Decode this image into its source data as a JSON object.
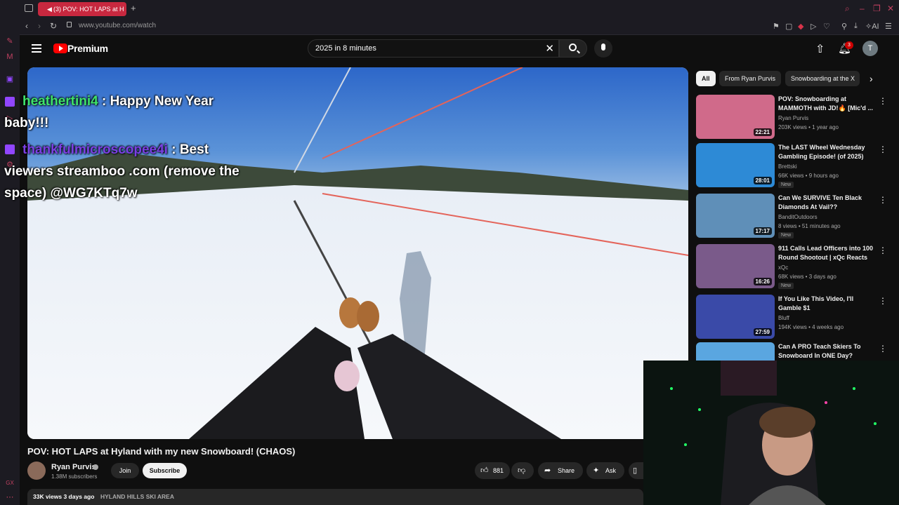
{
  "browser": {
    "tab_title": "(3) POV: HOT LAPS at H",
    "url": "www.youtube.com/watch",
    "new_tab": "+",
    "ai_label": "AI"
  },
  "youtube": {
    "brand": "Premium",
    "search_value": "2025 in 8 minutes",
    "notification_count": "3",
    "user_initial": "T"
  },
  "chat_overlay": [
    {
      "user": "heathertini4",
      "user_color": "#3fe36a",
      "text": " : Happy New Year",
      "text2": "baby!!!"
    },
    {
      "user": "thankfulmicroscopee4i",
      "user_color": "#7b3fe3",
      "text": " : Best",
      "text2": "viewers streamboo .com (remove the",
      "text3": "space) @WG7KTq7w"
    }
  ],
  "video": {
    "title": "POV: HOT LAPS at Hyland with my new Snowboard! (CHAOS)",
    "channel": "Ryan Purvis",
    "subscribers": "1.38M subscribers",
    "join_label": "Join",
    "subscribe_label": "Subscribe",
    "likes": "881",
    "share_label": "Share",
    "ask_label": "Ask",
    "views_date": "33K views  3 days ago",
    "tag": "HYLAND HILLS SKI AREA"
  },
  "chips": [
    "All",
    "From Ryan Purvis",
    "Snowboarding at the X"
  ],
  "recommendations": [
    {
      "title": "POV: Snowboarding at MAMMOTH with JD!🔥 [Mic'd ...",
      "channel": "Ryan Purvis",
      "meta": "203K views • 1 year ago",
      "duration": "22:21",
      "new": "",
      "thumb_color": "#d06a8a"
    },
    {
      "title": "The LAST Wheel Wednesday Gambling Episode! (of 2025)",
      "channel": "Brettski",
      "meta": "66K views • 9 hours ago",
      "duration": "28:01",
      "new": "New",
      "thumb_color": "#2d8ad6"
    },
    {
      "title": "Can We SURVIVE Ten Black Diamonds At Vail??",
      "channel": "BanditOutdoors",
      "meta": "8 views • 51 minutes ago",
      "duration": "17:17",
      "new": "New",
      "thumb_color": "#5f8fb8"
    },
    {
      "title": "911 Calls Lead Officers into 100 Round Shootout | xQc Reacts",
      "channel": "xQc",
      "meta": "68K views • 3 days ago",
      "duration": "16:26",
      "new": "New",
      "thumb_color": "#7a5a8a"
    },
    {
      "title": "If You Like This Video, I'll Gamble $1",
      "channel": "Bluff",
      "meta": "194K views • 4 weeks ago",
      "duration": "27:59",
      "new": "",
      "thumb_color": "#3a4aa8"
    },
    {
      "title": "Can A PRO Teach Skiers To Snowboard In ONE Day?",
      "channel": "",
      "meta": "",
      "duration": "",
      "new": "",
      "thumb_color": "#5aa6e0"
    }
  ]
}
